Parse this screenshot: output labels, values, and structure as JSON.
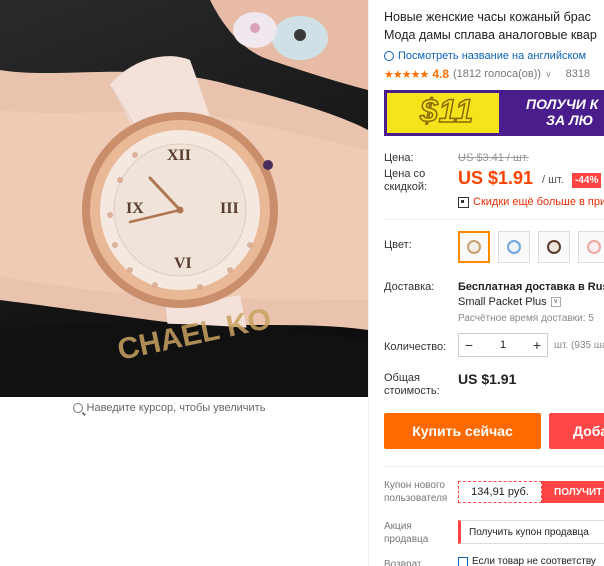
{
  "product": {
    "title_line1": "Новые женские часы кожаный брас",
    "title_line2": "Мода дамы сплава аналоговые квар",
    "translate_link": "Посмотреть название на английском",
    "rating_stars": "★★★★★",
    "rating_score": "4.8",
    "rating_votes": "(1812 голоса(ов))",
    "rating_chevron": "∨",
    "orders_count": "8318"
  },
  "image": {
    "zoom_hint": "Наведите курсор, чтобы увеличить"
  },
  "banner": {
    "amount": "$11",
    "line1": "ПОЛУЧИ К",
    "line2": "ЗА ЛЮ"
  },
  "price": {
    "label": "Цена:",
    "old": "US $3.41 / шт.",
    "discount_label": "Цена со скидкой:",
    "current": "US $1.91",
    "unit": "/ шт.",
    "discount_badge": "-44%",
    "app_deal": "Скидки ещё больше в при"
  },
  "color": {
    "label": "Цвет:",
    "options": [
      {
        "name": "white-strap",
        "color": "#f2ede6",
        "strap": "#111111",
        "selected": true
      },
      {
        "name": "blue-strap",
        "color": "#6fa7e0",
        "strap": "#6fa7e0",
        "selected": false
      },
      {
        "name": "brown-strap",
        "color": "#5a3a2a",
        "strap": "#5a3a2a",
        "selected": false
      },
      {
        "name": "pink-strap",
        "color": "#f0b8b0",
        "strap": "#e9a9a0",
        "selected": false
      }
    ]
  },
  "shipping": {
    "label": "Доставка:",
    "line1": "Бесплатная доставка в Russ",
    "method": "Small Packet Plus",
    "estimate": "Расчётное время доставки: 5"
  },
  "quantity": {
    "label": "Количество:",
    "minus": "−",
    "value": "1",
    "plus": "+",
    "stock": "шт. (935 ша"
  },
  "total": {
    "label": "Общая стоимость:",
    "value": "US $1.91"
  },
  "actions": {
    "buy_now": "Купить сейчас",
    "add_to_cart": "Доба"
  },
  "coupon": {
    "label": "Купон нового пользователя",
    "amount": "134,91 руб.",
    "button": "ПОЛУЧИТ"
  },
  "promo": {
    "label": "Акция продавца",
    "text": "Получить купон продавца"
  },
  "returns": {
    "label": "Возврат",
    "text": "Если товар не соответству"
  },
  "colors": {
    "accent_orange": "#ff6a00",
    "accent_red": "#ff4747",
    "price_red": "#ff4300",
    "link_blue": "#0e62b5"
  }
}
